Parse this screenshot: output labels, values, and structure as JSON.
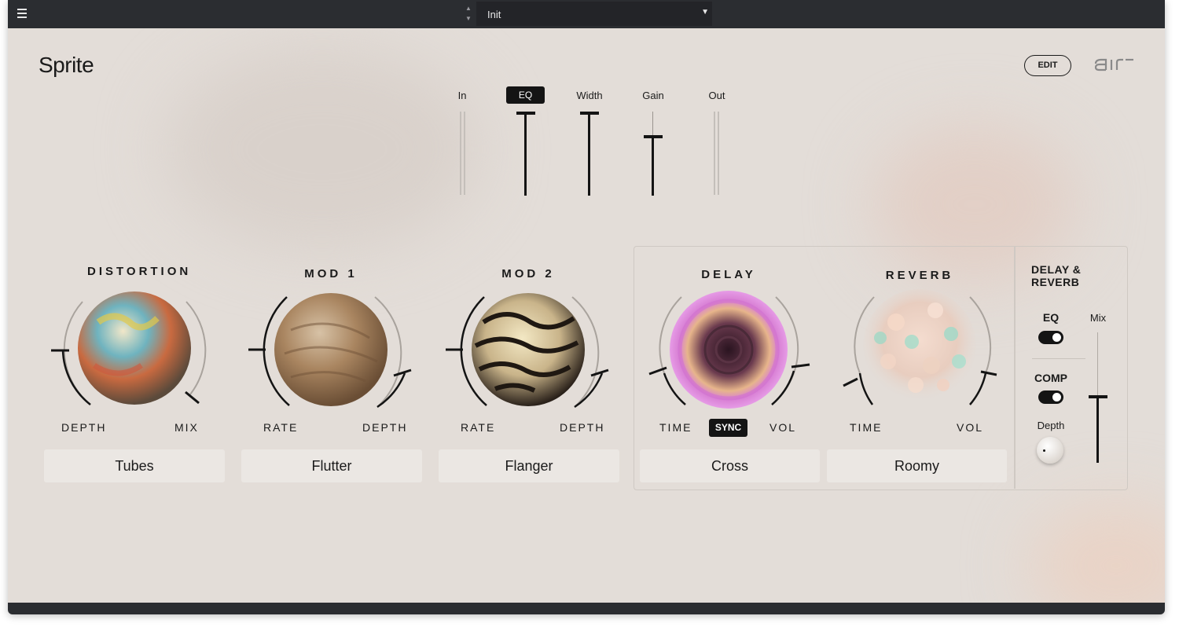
{
  "topbar": {
    "preset_name": "Init",
    "preset_up": "▲",
    "preset_down": "▼",
    "dropdown_arrow": "▼"
  },
  "header": {
    "title": "Sprite",
    "edit_label": "EDIT",
    "brand_logo": "air"
  },
  "mixer": {
    "in_label": "In",
    "eq_label": "EQ",
    "width_label": "Width",
    "gain_label": "Gain",
    "out_label": "Out"
  },
  "modules": {
    "distortion": {
      "title": "DISTORTION",
      "left_label": "DEPTH",
      "right_label": "MIX",
      "type": "Tubes"
    },
    "mod1": {
      "title": "MOD 1",
      "left_label": "RATE",
      "right_label": "DEPTH",
      "type": "Flutter"
    },
    "mod2": {
      "title": "MOD 2",
      "left_label": "RATE",
      "right_label": "DEPTH",
      "type": "Flanger"
    },
    "delay": {
      "title": "DELAY",
      "left_label": "TIME",
      "sync_label": "SYNC",
      "right_label": "VOL",
      "type": "Cross"
    },
    "reverb": {
      "title": "REVERB",
      "left_label": "TIME",
      "right_label": "VOL",
      "type": "Roomy"
    }
  },
  "delay_reverb": {
    "title_line1": "DELAY &",
    "title_line2": "REVERB",
    "eq_label": "EQ",
    "eq_on": true,
    "comp_label": "COMP",
    "comp_on": true,
    "depth_label": "Depth",
    "mix_label": "Mix"
  },
  "icons": {
    "menu": "hamburger-icon",
    "preset_stepper": "up-down-arrows-icon",
    "dropdown": "chevron-down-icon"
  }
}
